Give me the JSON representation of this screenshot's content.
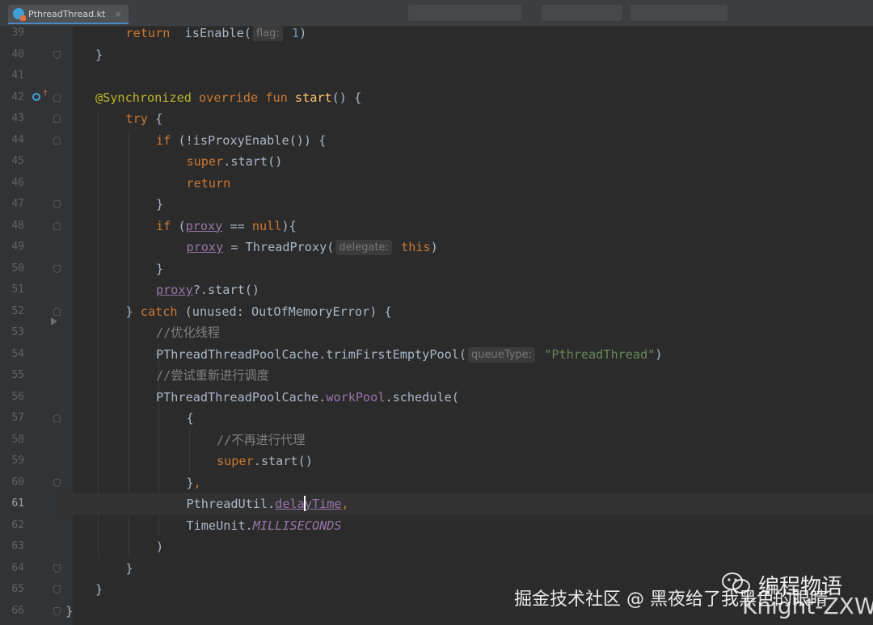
{
  "tab": {
    "file_name": "PthreadThread.kt",
    "close_label": "×"
  },
  "code": {
    "current_line": 61,
    "lines": [
      {
        "n": "39",
        "indent": 1,
        "fold": "",
        "tokens": [
          [
            "kw",
            "return"
          ],
          [
            "",
            "  isEnable("
          ],
          [
            "hint",
            "flag:"
          ],
          [
            "num",
            " 1"
          ],
          [
            "",
            ")"
          ]
        ]
      },
      {
        "n": "40",
        "indent": 0,
        "fold": "close",
        "tokens": [
          [
            "",
            "}"
          ]
        ]
      },
      {
        "n": "41",
        "indent": 0,
        "fold": "",
        "tokens": []
      },
      {
        "n": "42",
        "indent": 0,
        "fold": "open",
        "marker": true,
        "tokens": [
          [
            "ann",
            "@Synchronized"
          ],
          [
            "",
            " "
          ],
          [
            "kw",
            "override fun"
          ],
          [
            "",
            " "
          ],
          [
            "fn",
            "start"
          ],
          [
            "",
            "() {"
          ]
        ]
      },
      {
        "n": "43",
        "indent": 1,
        "fold": "open",
        "tokens": [
          [
            "kw",
            "try"
          ],
          [
            "",
            " {"
          ]
        ]
      },
      {
        "n": "44",
        "indent": 2,
        "fold": "open",
        "tokens": [
          [
            "kw",
            "if"
          ],
          [
            "",
            " (!isProxyEnable()) {"
          ]
        ]
      },
      {
        "n": "45",
        "indent": 3,
        "fold": "",
        "tokens": [
          [
            "kw",
            "super"
          ],
          [
            "",
            ".start()"
          ]
        ]
      },
      {
        "n": "46",
        "indent": 3,
        "fold": "",
        "tokens": [
          [
            "kw",
            "return"
          ]
        ]
      },
      {
        "n": "47",
        "indent": 2,
        "fold": "close",
        "tokens": [
          [
            "",
            "}"
          ]
        ]
      },
      {
        "n": "48",
        "indent": 2,
        "fold": "open",
        "tokens": [
          [
            "kw",
            "if"
          ],
          [
            "",
            " ("
          ],
          [
            "propu",
            "proxy"
          ],
          [
            "",
            " == "
          ],
          [
            "kw",
            "null"
          ],
          [
            "",
            "){"
          ]
        ]
      },
      {
        "n": "49",
        "indent": 3,
        "fold": "",
        "tokens": [
          [
            "propu",
            "proxy"
          ],
          [
            "",
            " = ThreadProxy("
          ],
          [
            "hint",
            "delegate:"
          ],
          [
            "",
            " "
          ],
          [
            "kw",
            "this"
          ],
          [
            "",
            ")"
          ]
        ]
      },
      {
        "n": "50",
        "indent": 2,
        "fold": "close",
        "tokens": [
          [
            "",
            "}"
          ]
        ]
      },
      {
        "n": "51",
        "indent": 2,
        "fold": "",
        "tokens": [
          [
            "propu",
            "proxy"
          ],
          [
            "",
            "?.start()"
          ]
        ]
      },
      {
        "n": "52",
        "indent": 1,
        "fold": "open",
        "tokens": [
          [
            "",
            "} "
          ],
          [
            "kw",
            "catch"
          ],
          [
            "",
            " (unused: OutOfMemoryError) {"
          ]
        ]
      },
      {
        "n": "53",
        "indent": 2,
        "fold": "",
        "arrow": true,
        "tokens": [
          [
            "cmt",
            "//优化线程"
          ]
        ]
      },
      {
        "n": "54",
        "indent": 2,
        "fold": "",
        "tokens": [
          [
            "",
            "PThreadThreadPoolCache.trimFirstEmptyPool("
          ],
          [
            "hint",
            "queueType:"
          ],
          [
            "",
            " "
          ],
          [
            "str",
            "\"PthreadThread\""
          ],
          [
            "",
            ")"
          ]
        ]
      },
      {
        "n": "55",
        "indent": 2,
        "fold": "",
        "tokens": [
          [
            "cmt",
            "//尝试重新进行调度"
          ]
        ]
      },
      {
        "n": "56",
        "indent": 2,
        "fold": "",
        "tokens": [
          [
            "",
            "PThreadThreadPoolCache."
          ],
          [
            "prop",
            "workPool"
          ],
          [
            "",
            ".schedule("
          ]
        ]
      },
      {
        "n": "57",
        "indent": 3,
        "fold": "open",
        "tokens": [
          [
            "",
            "{"
          ]
        ]
      },
      {
        "n": "58",
        "indent": 4,
        "fold": "",
        "tokens": [
          [
            "cmt",
            "//不再进行代理"
          ]
        ]
      },
      {
        "n": "59",
        "indent": 4,
        "fold": "",
        "tokens": [
          [
            "kw",
            "super"
          ],
          [
            "",
            ".start()"
          ]
        ]
      },
      {
        "n": "60",
        "indent": 3,
        "fold": "close",
        "tokens": [
          [
            "",
            "}"
          ],
          [
            "kw",
            ","
          ]
        ]
      },
      {
        "n": "61",
        "indent": 3,
        "fold": "",
        "tokens": [
          [
            "",
            "PthreadUtil."
          ],
          [
            "propu",
            "dela"
          ],
          [
            "caret",
            ""
          ],
          [
            "propu",
            "yTime"
          ],
          [
            "kw",
            ","
          ]
        ]
      },
      {
        "n": "62",
        "indent": 3,
        "fold": "",
        "tokens": [
          [
            "",
            "TimeUnit."
          ],
          [
            "ital",
            "MILLISECONDS"
          ]
        ]
      },
      {
        "n": "63",
        "indent": 2,
        "fold": "",
        "tokens": [
          [
            "",
            ")"
          ]
        ]
      },
      {
        "n": "64",
        "indent": 1,
        "fold": "close",
        "tokens": [
          [
            "",
            "}"
          ]
        ]
      },
      {
        "n": "65",
        "indent": 0,
        "fold": "close",
        "tokens": [
          [
            "",
            "}"
          ]
        ]
      },
      {
        "n": "66",
        "indent": -1,
        "fold": "close",
        "tokens": [
          [
            "",
            "}"
          ]
        ]
      }
    ]
  },
  "watermark": {
    "platform": "掘金技术社区 @ 黑夜给了我黑色的眼睛",
    "account": "编程物语",
    "author": "Knight-ZXW"
  },
  "colors": {
    "editor_bg": "#2b2b2b",
    "gutter_bg": "#313335",
    "keyword": "#cc7832",
    "function": "#ffc66d",
    "annotation": "#bbb529",
    "number": "#6897bb",
    "string": "#6a8759",
    "comment": "#808080",
    "property": "#9876aa"
  },
  "icons": {
    "tab": "kotlin-file-icon",
    "gutter_marker": "override-method-icon",
    "fold": "fold-marker-icon"
  }
}
